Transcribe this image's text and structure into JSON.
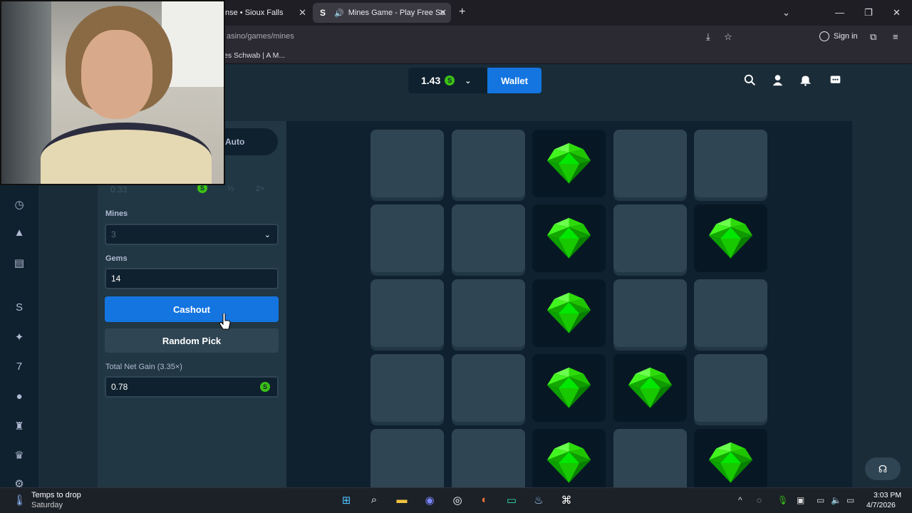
{
  "browser": {
    "tabs": [
      {
        "label": "nse • Sioux Falls"
      },
      {
        "label": "Mines Game - Play Free So"
      }
    ],
    "url": "asino/games/mines",
    "bookmark": "es Schwab | A M...",
    "signin_label": "Sign in"
  },
  "header": {
    "balance": "1.43",
    "currency_symbol": "S",
    "wallet_label": "Wallet"
  },
  "panel": {
    "mode_label": "Auto",
    "bet_amount": "0.33",
    "bet_half": "½",
    "bet_double": "2×",
    "mines_label": "Mines",
    "mines_value": "3",
    "gems_label": "Gems",
    "gems_value": "14",
    "cashout_label": "Cashout",
    "random_pick_label": "Random Pick",
    "net_gain_label": "Total Net Gain (3.35×)",
    "net_gain_value": "0.78"
  },
  "board": {
    "rows": 5,
    "cols": 5,
    "tiles": [
      [
        "hidden",
        "hidden",
        "gem",
        "hidden",
        "hidden"
      ],
      [
        "hidden",
        "hidden",
        "gem",
        "hidden",
        "gem"
      ],
      [
        "hidden",
        "hidden",
        "gem",
        "hidden",
        "hidden"
      ],
      [
        "hidden",
        "hidden",
        "gem",
        "gem",
        "hidden"
      ],
      [
        "hidden",
        "hidden",
        "gem",
        "hidden",
        "gem"
      ]
    ],
    "gem_color": "#00e701"
  },
  "taskbar": {
    "weather_title": "Temps to drop",
    "weather_sub": "Saturday",
    "time": "3:03 PM",
    "date": "4/7/2026"
  },
  "colors": {
    "accent": "#1475e1",
    "coin": "#3bc117",
    "panel": "#213743",
    "board": "#0f212e"
  }
}
